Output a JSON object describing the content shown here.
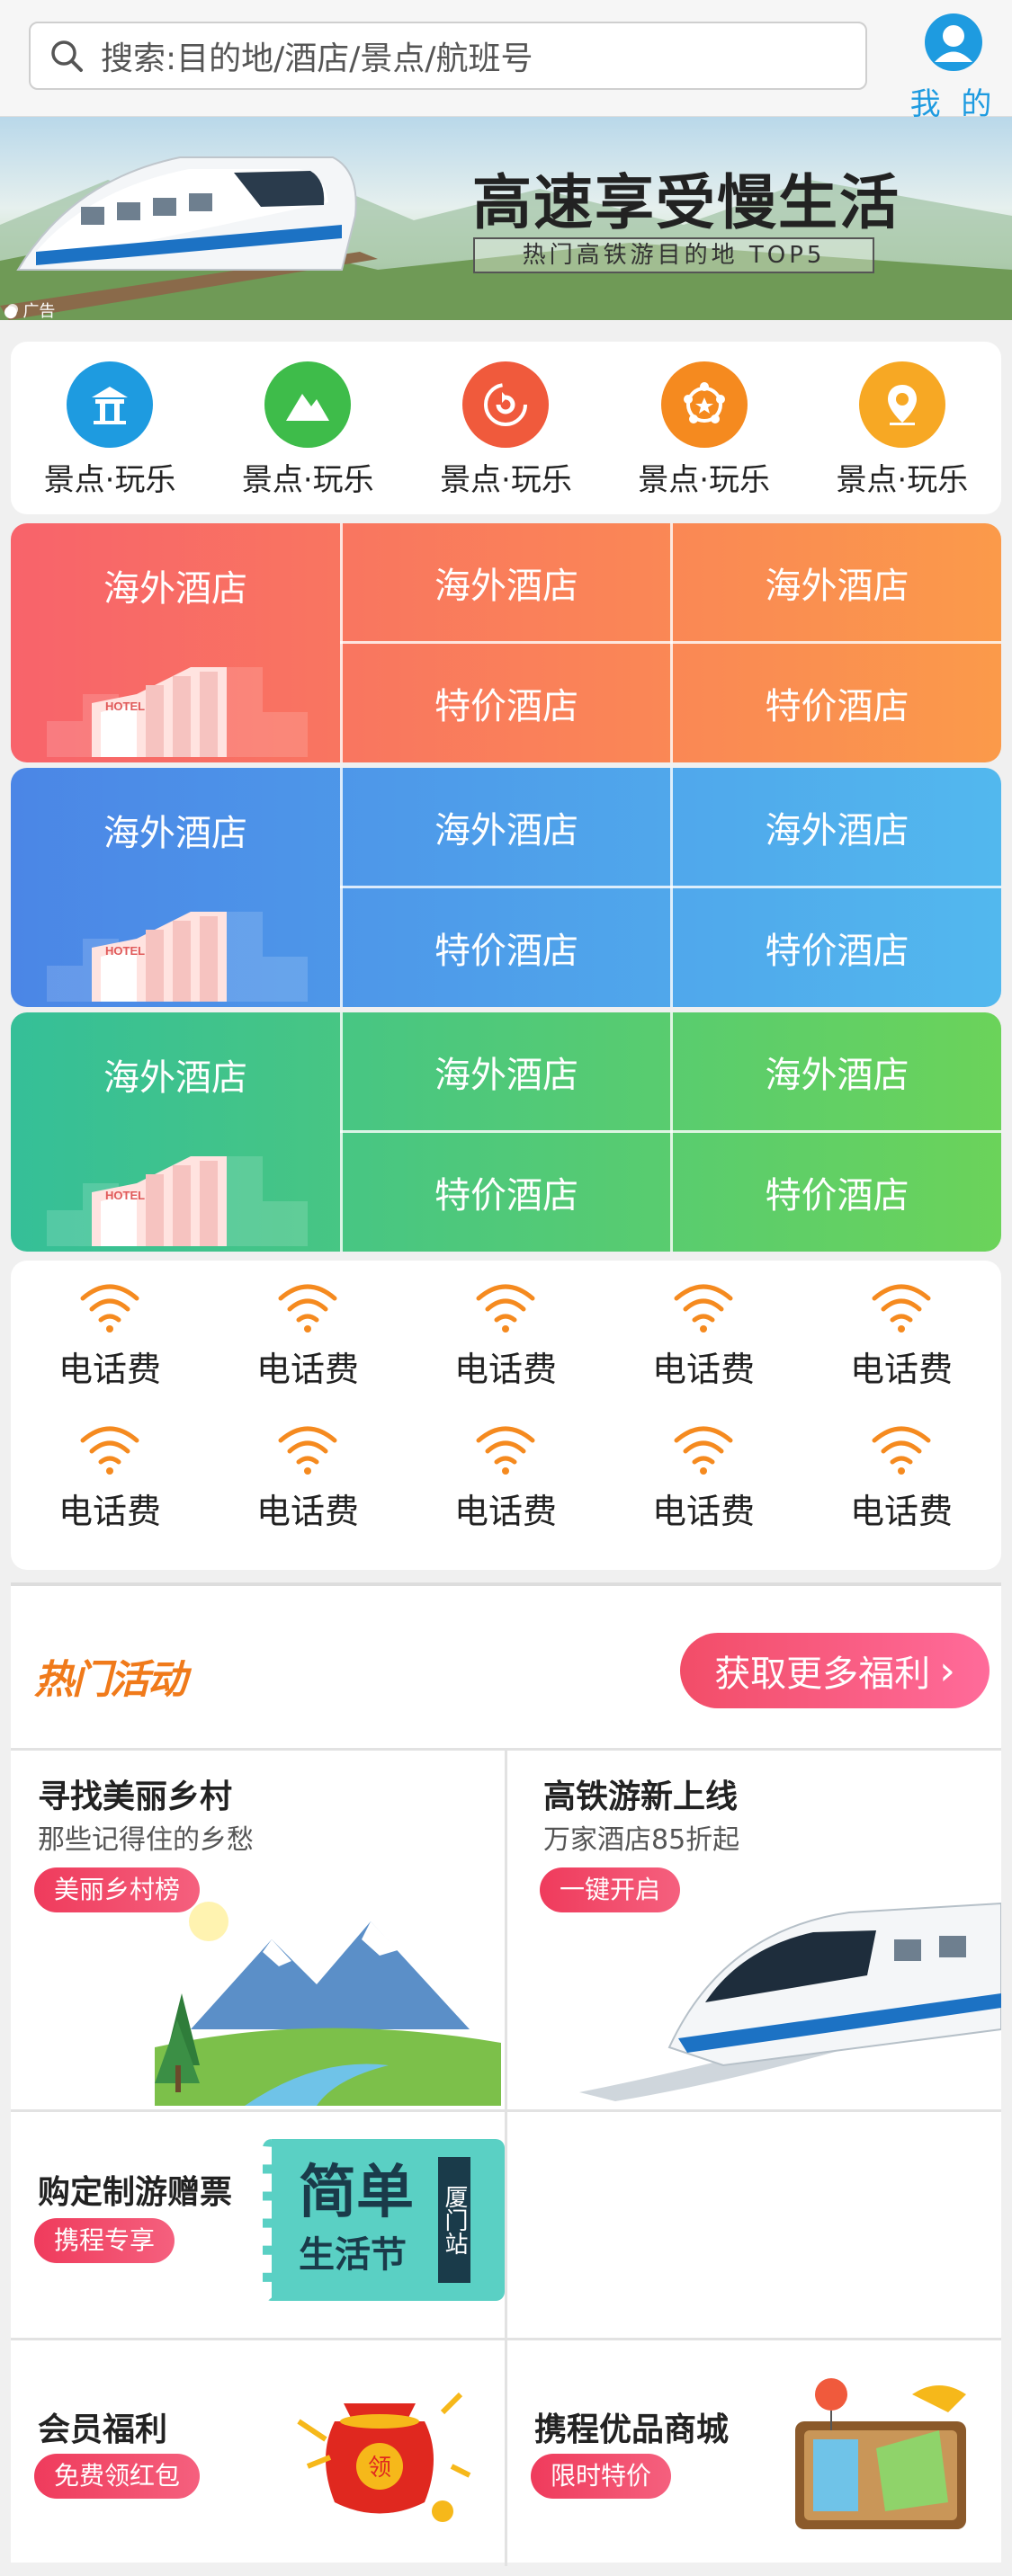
{
  "search": {
    "placeholder": "搜索:目的地/酒店/景点/航班号"
  },
  "mine": {
    "label": "我 的"
  },
  "banner": {
    "title": "高速享受慢生活",
    "subtitle": "热门高铁游目的地 TOP5",
    "ad_tag": "广告"
  },
  "categories": [
    {
      "label": "景点·玩乐",
      "icon": "pavilion-icon",
      "color": "#1e9be0"
    },
    {
      "label": "景点·玩乐",
      "icon": "mountain-icon",
      "color": "#3ebc4a"
    },
    {
      "label": "景点·玩乐",
      "icon": "refresh-badge-icon",
      "color": "#f05a3c"
    },
    {
      "label": "景点·玩乐",
      "icon": "badge-star-icon",
      "color": "#f58a1f"
    },
    {
      "label": "景点·玩乐",
      "icon": "location-pin-icon",
      "color": "#f7a824"
    }
  ],
  "hotel_rows": [
    {
      "big": "海外酒店",
      "top_mid": "海外酒店",
      "top_right": "海外酒店",
      "bottom_mid": "特价酒店",
      "bottom_right": "特价酒店",
      "hotel_sign": "HOTEL",
      "color_from": "#f8636b",
      "color_to": "#fb9a4a"
    },
    {
      "big": "海外酒店",
      "top_mid": "海外酒店",
      "top_right": "海外酒店",
      "bottom_mid": "特价酒店",
      "bottom_right": "特价酒店",
      "hotel_sign": "HOTEL",
      "color_from": "#4b86e6",
      "color_to": "#52b8ee"
    },
    {
      "big": "海外酒店",
      "top_mid": "海外酒店",
      "top_right": "海外酒店",
      "bottom_mid": "特价酒店",
      "bottom_right": "特价酒店",
      "hotel_sign": "HOTEL",
      "color_from": "#35bf98",
      "color_to": "#6bd35a"
    }
  ],
  "phone_items": [
    "电话费",
    "电话费",
    "电话费",
    "电话费",
    "电话费",
    "电话费",
    "电话费",
    "电话费",
    "电话费",
    "电话费"
  ],
  "activity": {
    "title": "热门活动",
    "more_label": "获取更多福利",
    "cards": [
      {
        "title": "寻找美丽乡村",
        "subtitle": "那些记得住的乡愁",
        "pill": "美丽乡村榜"
      },
      {
        "title": "高铁游新上线",
        "subtitle": "万家酒店85折起",
        "pill": "一键开启"
      },
      {
        "title": "购定制游赠票",
        "subtitle": "",
        "pill": "携程专享",
        "ticket_main": "简单",
        "ticket_sub": "生活节",
        "ticket_side": "厦门站"
      },
      {
        "title": "会员福利",
        "subtitle": "",
        "pill": "免费领红包",
        "bag_text": "领"
      },
      {
        "title": "携程优品商城",
        "subtitle": "",
        "pill": "限时特价"
      }
    ]
  }
}
